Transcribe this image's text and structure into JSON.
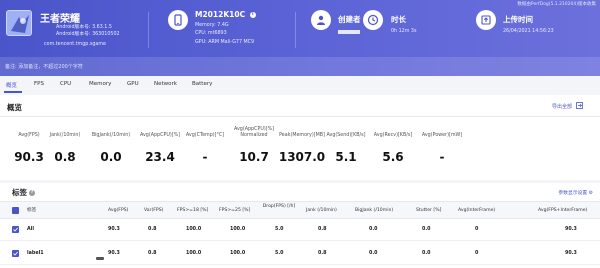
{
  "header": {
    "data_source": "数据由PerfDog(5.1.210204)版本收集",
    "app": {
      "name": "王者荣耀",
      "android_version": "Android版本号: 3.63.1.5",
      "android_build": "Android版本号: 363010502",
      "package": "com.tencent.tmgp.sgame"
    },
    "device": {
      "model": "M2012K10C",
      "memory": "Memory: 7.4G",
      "cpu": "CPU: mt6893",
      "gpu": "GPU: ARM Mali-G77 MC9"
    },
    "creator": {
      "title": "创建者"
    },
    "duration": {
      "title": "时长",
      "value": "0h 12m 3s"
    },
    "upload": {
      "title": "上传时间",
      "value": "26/04/2021 14:56:23"
    },
    "note": "备注: 添加备注，不超过200个字符"
  },
  "tabs": [
    "概览",
    "FPS",
    "CPU",
    "Memory",
    "GPU",
    "Network",
    "Battery"
  ],
  "overview": {
    "title": "概览",
    "export_label": "导出全部",
    "metrics": [
      {
        "label": [
          "Avg(FPS)"
        ],
        "value": "90.3"
      },
      {
        "label": [
          "Jank(/10min)"
        ],
        "value": "0.8"
      },
      {
        "label": [
          "BigJank(/10min)"
        ],
        "value": "0.0"
      },
      {
        "label": [
          "Avg(AppCPU)[%]"
        ],
        "value": "23.4"
      },
      {
        "label": [
          "Avg(CTemp)[°C]"
        ],
        "value": "-"
      },
      {
        "label": [
          "Avg(AppCPU)[%]",
          "Normalized"
        ],
        "value": "10.7"
      },
      {
        "label": [
          "Peak(Memory)[MB]"
        ],
        "value": "1307.0"
      },
      {
        "label": [
          "Avg(Send)[KB/s]"
        ],
        "value": "5.1"
      },
      {
        "label": [
          "Avg(Recv)[KB/s]"
        ],
        "value": "5.6"
      },
      {
        "label": [
          "Avg(Power)[mW]"
        ],
        "value": "-"
      }
    ]
  },
  "tags": {
    "title": "标签",
    "settings_label": "参数显示设置",
    "columns": [
      "标签",
      "Avg(FPS)",
      "Var(FPS)",
      "FPS>=18 [%]",
      "FPS>=25 [%]",
      "Drop(FPS) [/h]",
      "Jank (/10min)",
      "BigJank (/10min)",
      "Stutter [%]",
      "Avg(InterFrame)",
      "Avg(FPS+InterFrame)"
    ],
    "rows": [
      {
        "name": "All",
        "cells": [
          "90.3",
          "0.8",
          "100.0",
          "100.0",
          "5.0",
          "0.8",
          "0.0",
          "0.0",
          "0",
          "90.3"
        ]
      },
      {
        "name": "label1",
        "cells": [
          "90.3",
          "0.8",
          "100.0",
          "100.0",
          "5.0",
          "0.8",
          "0.0",
          "0.0",
          "0",
          "90.3"
        ]
      }
    ]
  }
}
